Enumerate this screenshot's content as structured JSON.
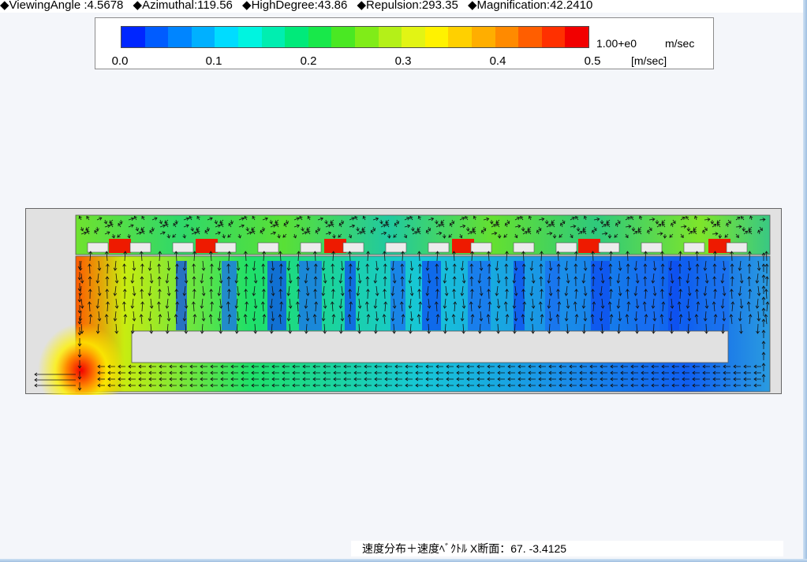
{
  "header": {
    "params": [
      {
        "icon": "diamond-bullet-icon",
        "text": "◆ViewingAngle :4.5678"
      },
      {
        "icon": "diamond-bullet-icon",
        "text": "◆Azimuthal:119.56"
      },
      {
        "icon": "diamond-bullet-icon",
        "text": "◆HighDegree:43.86"
      },
      {
        "icon": "diamond-bullet-icon",
        "text": "◆Repulsion:293.35"
      },
      {
        "icon": "diamond-bullet-icon",
        "text": "◆Magnification:42.2410"
      }
    ]
  },
  "legend": {
    "colors": [
      "#0026ff",
      "#005cff",
      "#0085ff",
      "#00b0ff",
      "#00dcff",
      "#00f4e0",
      "#00eeb0",
      "#00ea7a",
      "#18e84a",
      "#4ae823",
      "#80ec18",
      "#b4f018",
      "#e2f414",
      "#fff200",
      "#ffd000",
      "#ffae00",
      "#ff8a00",
      "#ff5e00",
      "#ff3000",
      "#f20000"
    ],
    "ticks": [
      "0.0",
      "0.1",
      "0.2",
      "0.3",
      "0.4",
      "0.5"
    ],
    "scale_exponent": "1.00+e0",
    "unit": "m/sec",
    "axis_unit": "[m/sec]"
  },
  "caption": "速度分布＋速度ﾍﾞｸﾄﾙ X断面：67.  -3.4125"
}
